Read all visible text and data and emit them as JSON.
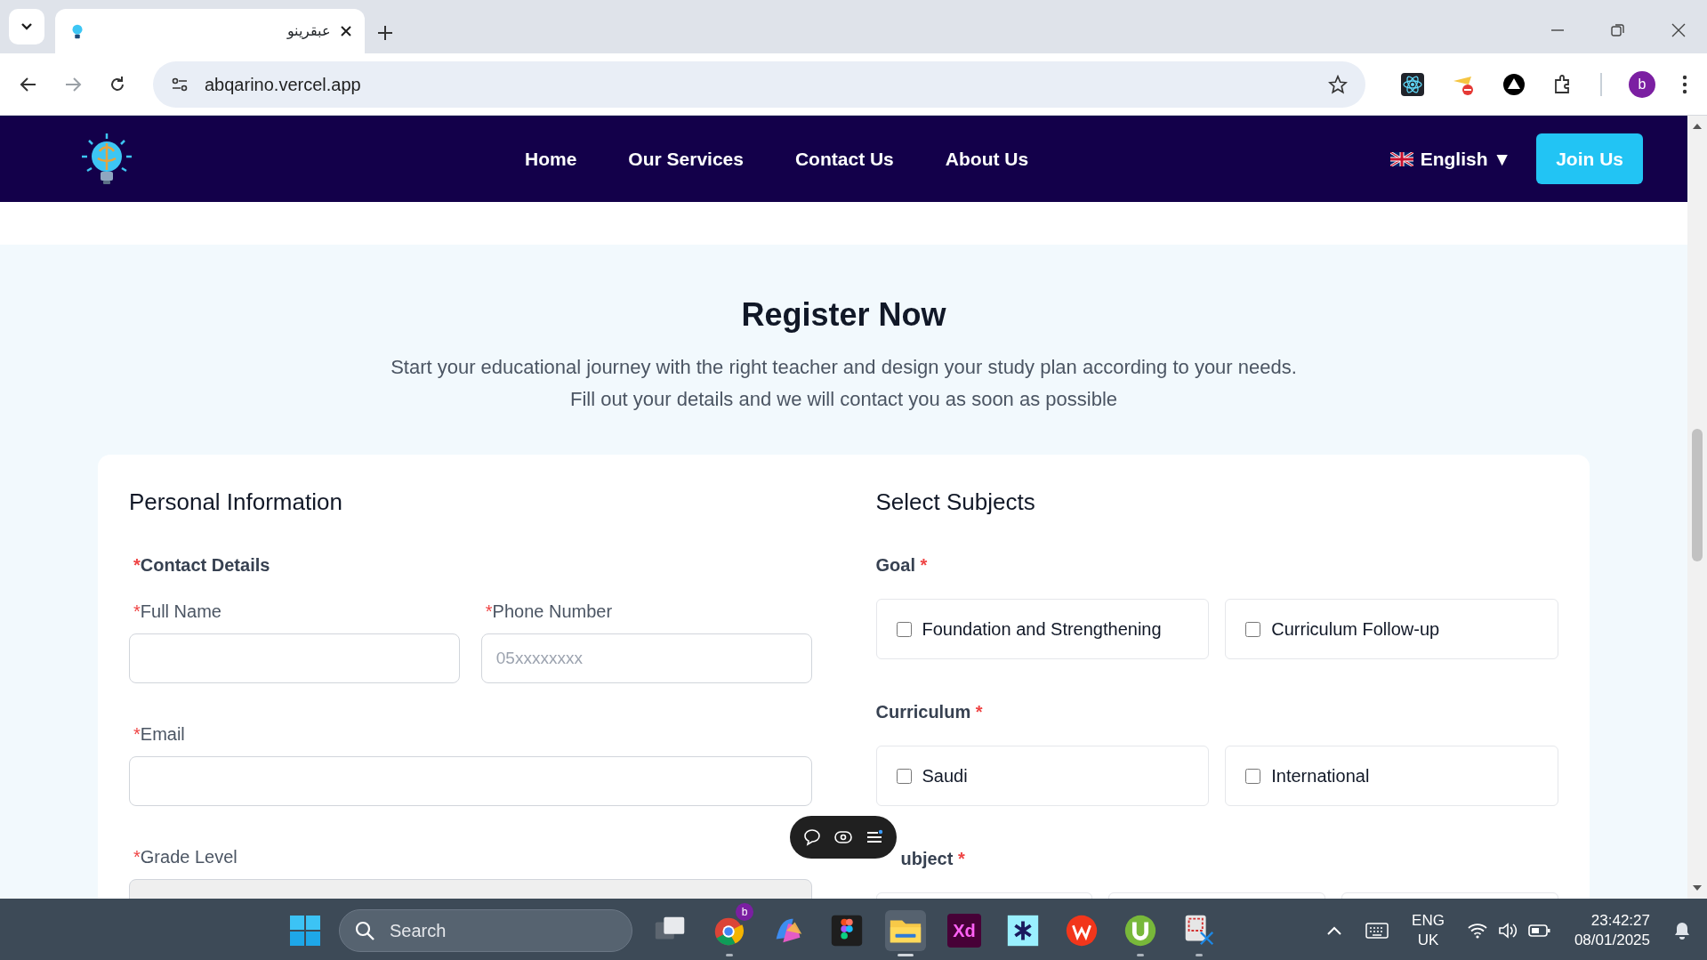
{
  "browser": {
    "tabs": [
      {
        "title": "عبقرينو",
        "selected": true
      }
    ],
    "address": "abqarino.vercel.app",
    "profile": "b"
  },
  "navbar": {
    "links": [
      {
        "label": "Home"
      },
      {
        "label": "Our Services"
      },
      {
        "label": "Contact Us"
      },
      {
        "label": "About Us"
      }
    ],
    "language": "English",
    "language_caret": "▼",
    "join": "Join Us"
  },
  "hero": {
    "title": "Register Now",
    "lines": [
      "Start your educational journey with the right teacher and design your study plan according to your needs.",
      "Fill out your details and we will contact you as soon as possible"
    ]
  },
  "personal": {
    "title": "Personal Information",
    "section": {
      "label": "Contact Details",
      "mark": "*"
    },
    "fields": [
      {
        "label": "Full Name",
        "mark": "*",
        "kind": "half"
      },
      {
        "label": "Phone Number",
        "mark": "*",
        "kind": "half",
        "placeholder": "05xxxxxxxx"
      },
      {
        "label": "Email",
        "mark": "*",
        "kind": "full"
      },
      {
        "label": "Grade Level",
        "mark": "*",
        "kind": "select"
      }
    ]
  },
  "subjects": {
    "title": "Select Subjects",
    "groups": [
      {
        "label": "Goal",
        "mark": "*",
        "kind": "options",
        "options": [
          {
            "label": "Foundation and Strengthening",
            "checked": false
          },
          {
            "label": "Curriculum Follow-up",
            "checked": false
          }
        ]
      },
      {
        "label": "Curriculum",
        "mark": "*",
        "kind": "options",
        "options": [
          {
            "label": "Saudi",
            "checked": false
          },
          {
            "label": "International",
            "checked": false
          }
        ]
      },
      {
        "label": "ubject",
        "mark": "*",
        "kind": "cut-off"
      }
    ]
  },
  "taskbar": {
    "search": "Search",
    "apps": [
      {
        "kind": "taskview"
      },
      {
        "kind": "chrome",
        "badge": "b",
        "running": true
      },
      {
        "kind": "copilot"
      },
      {
        "kind": "figma"
      },
      {
        "kind": "explorer",
        "active": true
      },
      {
        "kind": "xd",
        "label": "Xd"
      },
      {
        "kind": "asterisk"
      },
      {
        "kind": "wps"
      },
      {
        "kind": "torrent",
        "running": true
      },
      {
        "kind": "snip",
        "running": true
      }
    ],
    "lang": "ENG",
    "region": "UK",
    "time": "23:42:27",
    "date": "08/01/2025"
  }
}
